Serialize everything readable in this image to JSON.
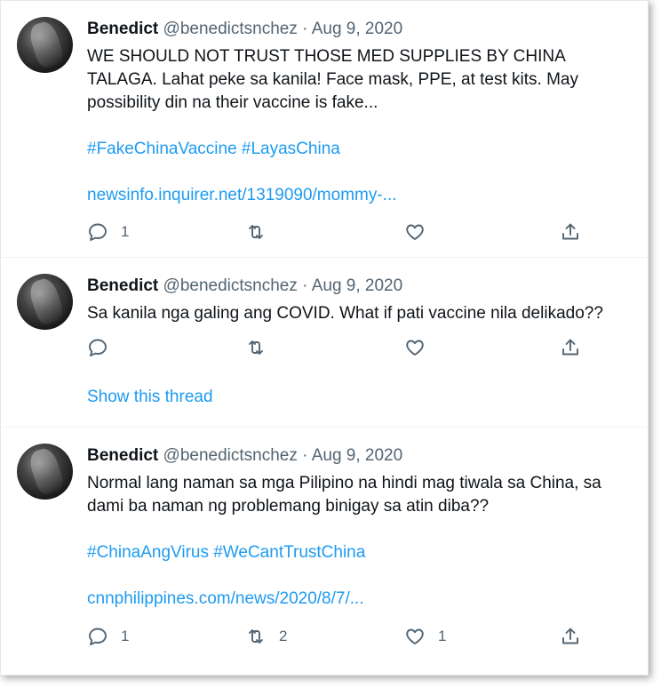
{
  "tweets": [
    {
      "name": "Benedict",
      "handle": "@benedictsnchez",
      "separator": "·",
      "date": "Aug 9, 2020",
      "text": "WE SHOULD NOT TRUST THOSE MED SUPPLIES BY CHINA TALAGA. Lahat peke sa kanila! Face mask, PPE, at test kits. May possibility din na their vaccine is fake...",
      "hashtags": "#FakeChinaVaccine #LayasChina",
      "link": "newsinfo.inquirer.net/1319090/mommy-...",
      "reply_count": "1",
      "retweet_count": "",
      "like_count": ""
    },
    {
      "name": "Benedict",
      "handle": "@benedictsnchez",
      "separator": "·",
      "date": "Aug 9, 2020",
      "text": "Sa kanila nga galing ang COVID. What if pati vaccine nila delikado??",
      "reply_count": "",
      "retweet_count": "",
      "like_count": "",
      "thread_link": "Show this thread"
    },
    {
      "name": "Benedict",
      "handle": "@benedictsnchez",
      "separator": "·",
      "date": "Aug 9, 2020",
      "text": "Normal lang naman sa mga Pilipino na hindi mag tiwala sa China, sa dami ba naman ng problemang binigay sa atin diba??",
      "hashtags": "#ChinaAngVirus #WeCantTrustChina",
      "link": "cnnphilippines.com/news/2020/8/7/...",
      "reply_count": "1",
      "retweet_count": "2",
      "like_count": "1"
    }
  ],
  "icons": {
    "reply": "reply-icon",
    "retweet": "retweet-icon",
    "like": "heart-icon",
    "share": "share-icon"
  },
  "colors": {
    "link": "#1d9bf0",
    "secondary_text": "#536471",
    "primary_text": "#0f1419",
    "divider": "#eff3f4"
  }
}
